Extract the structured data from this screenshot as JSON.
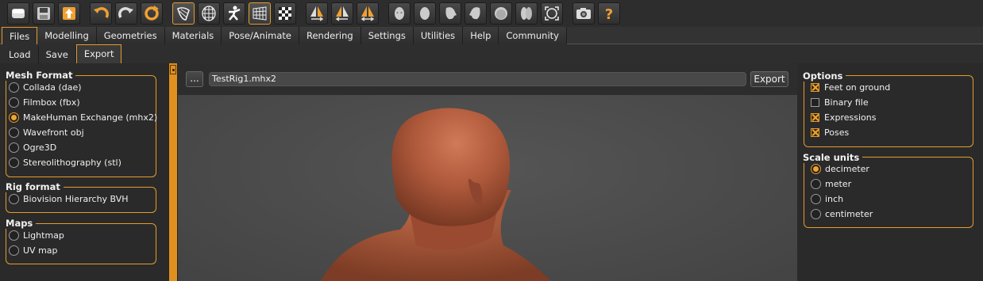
{
  "toolbar": {
    "icons": [
      "app-icon",
      "save-icon",
      "export-icon",
      "undo-icon",
      "redo-icon",
      "reset-icon",
      "smooth-icon",
      "wireframe-icon",
      "pose-icon",
      "background-grid-icon",
      "checker-icon",
      "symmetry-right-icon",
      "symmetry-left-icon",
      "symmetry-icon",
      "front-view-icon",
      "back-view-icon",
      "left-view-icon",
      "right-view-icon",
      "top-view-icon",
      "bottom-view-icon",
      "reset-camera-icon",
      "screenshot-icon",
      "help-icon"
    ],
    "accent": "#e59c2a"
  },
  "tabs": [
    "Files",
    "Modelling",
    "Geometries",
    "Materials",
    "Pose/Animate",
    "Rendering",
    "Settings",
    "Utilities",
    "Help",
    "Community"
  ],
  "active_tab": "Files",
  "subtabs": [
    "Load",
    "Save",
    "Export"
  ],
  "active_subtab": "Export",
  "left": {
    "mesh_format": {
      "title": "Mesh Format",
      "options": [
        "Collada (dae)",
        "Filmbox (fbx)",
        "MakeHuman Exchange (mhx2)",
        "Wavefront obj",
        "Ogre3D",
        "Stereolithography (stl)"
      ],
      "selected": "MakeHuman Exchange (mhx2)"
    },
    "rig_format": {
      "title": "Rig format",
      "options": [
        "Biovision Hierarchy BVH"
      ]
    },
    "maps": {
      "title": "Maps",
      "options": [
        "Lightmap",
        "UV map"
      ]
    }
  },
  "center": {
    "browse_label": "...",
    "filename": "TestRig1.mhx2",
    "export_label": "Export",
    "skin_color": "#b05a3c"
  },
  "right": {
    "options": {
      "title": "Options",
      "items": [
        {
          "label": "Feet on ground",
          "checked": true
        },
        {
          "label": "Binary file",
          "checked": false
        },
        {
          "label": "Expressions",
          "checked": true
        },
        {
          "label": "Poses",
          "checked": true
        }
      ]
    },
    "scale_units": {
      "title": "Scale units",
      "options": [
        "decimeter",
        "meter",
        "inch",
        "centimeter"
      ],
      "selected": "decimeter"
    }
  }
}
